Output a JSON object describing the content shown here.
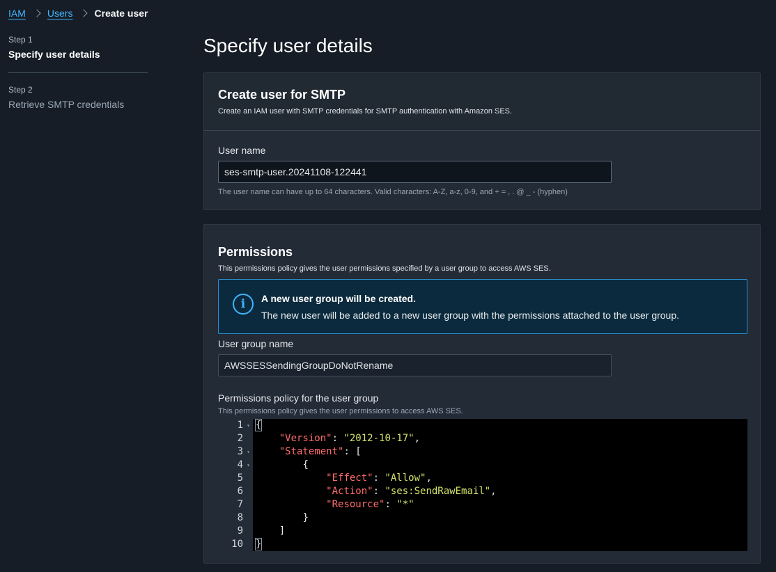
{
  "breadcrumb": {
    "items": [
      "IAM",
      "Users"
    ],
    "current": "Create user"
  },
  "steps": [
    {
      "num": "Step 1",
      "title": "Specify user details"
    },
    {
      "num": "Step 2",
      "title": "Retrieve SMTP credentials"
    }
  ],
  "page_title": "Specify user details",
  "smtp": {
    "title": "Create user for SMTP",
    "description": "Create an IAM user with SMTP credentials for SMTP authentication with Amazon SES.",
    "user_name_label": "User name",
    "user_name_value": "ses-smtp-user.20241108-122441",
    "user_name_hint": "The user name can have up to 64 characters. Valid characters: A-Z, a-z, 0-9, and + = , . @ _ - (hyphen)"
  },
  "permissions": {
    "title": "Permissions",
    "description": "This permissions policy gives the user permissions specified by a user group to access AWS SES.",
    "alert_title": "A new user group will be created.",
    "alert_text": "The new user will be added to a new user group with the permissions attached to the user group.",
    "group_label": "User group name",
    "group_value": "AWSSESSendingGroupDoNotRename",
    "policy_label": "Permissions policy for the user group",
    "policy_description": "This permissions policy gives the user permissions to access AWS SES.",
    "line_numbers": [
      "1",
      "2",
      "3",
      "4",
      "5",
      "6",
      "7",
      "8",
      "9",
      "10"
    ],
    "code": {
      "l1": "{",
      "version_key": "\"Version\"",
      "version_val": "\"2012-10-17\"",
      "statement_key": "\"Statement\"",
      "l3_tail": ": [",
      "l4": "{",
      "effect_key": "\"Effect\"",
      "effect_val": "\"Allow\"",
      "action_key": "\"Action\"",
      "action_val": "\"ses:SendRawEmail\"",
      "resource_key": "\"Resource\"",
      "resource_val": "\"*\"",
      "l8": "}",
      "l9": "]",
      "l10": "}"
    }
  },
  "icons": {
    "info": "i"
  }
}
